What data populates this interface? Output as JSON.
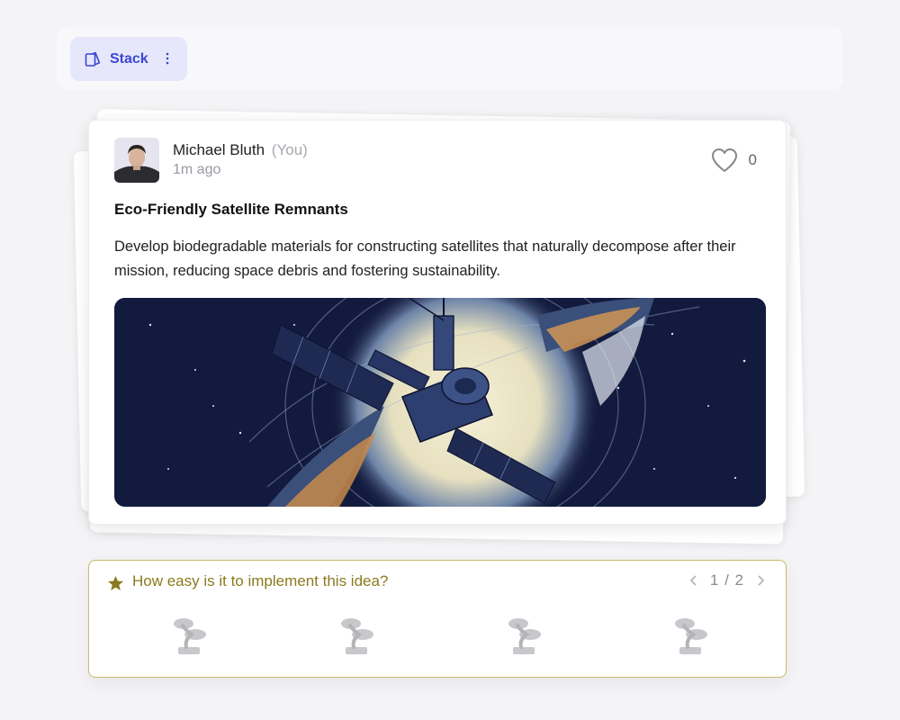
{
  "toolbar": {
    "stack_label": "Stack",
    "stack_icon": "cards-icon",
    "more_icon": "more-vertical-icon"
  },
  "post": {
    "author_name": "Michael Bluth",
    "author_tag": "(You)",
    "time": "1m ago",
    "likes": "0",
    "title": "Eco-Friendly Satellite Remnants",
    "description": "Develop biodegradable materials for constructing satellites that naturally decompose after their mission, reducing space debris and fostering sustainability.",
    "image_icon": "satellite-illustration"
  },
  "question": {
    "text": "How easy is it to implement this idea?",
    "page": "1 / 2",
    "options_icon": "bonsai-tree-icon",
    "option_count": 4
  },
  "colors": {
    "accent": "#3b46d6",
    "question_border": "#c9b96a",
    "question_text": "#8a7a1e"
  }
}
